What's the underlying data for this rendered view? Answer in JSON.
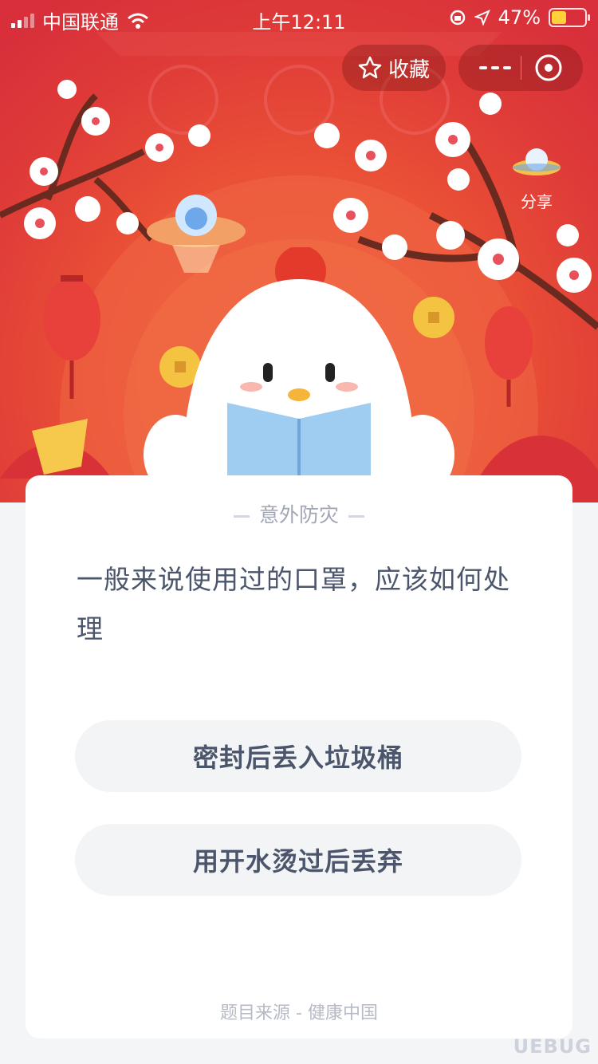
{
  "status_bar": {
    "carrier": "中国联通",
    "time": "上午12:11",
    "battery": "47%"
  },
  "header": {
    "favorite_label": "收藏",
    "share_label": "分享"
  },
  "quiz": {
    "category": "意外防灾",
    "question": "一般来说使用过的口罩，应该如何处理",
    "options": [
      {
        "label": "密封后丢入垃圾桶"
      },
      {
        "label": "用开水烫过后丢弃"
      }
    ],
    "source": "题目来源 - 健康中国"
  },
  "watermark": "UEBUG",
  "colors": {
    "hero_red": "#df3b38",
    "text_primary": "#4b556b",
    "option_bg": "#f3f4f6"
  }
}
